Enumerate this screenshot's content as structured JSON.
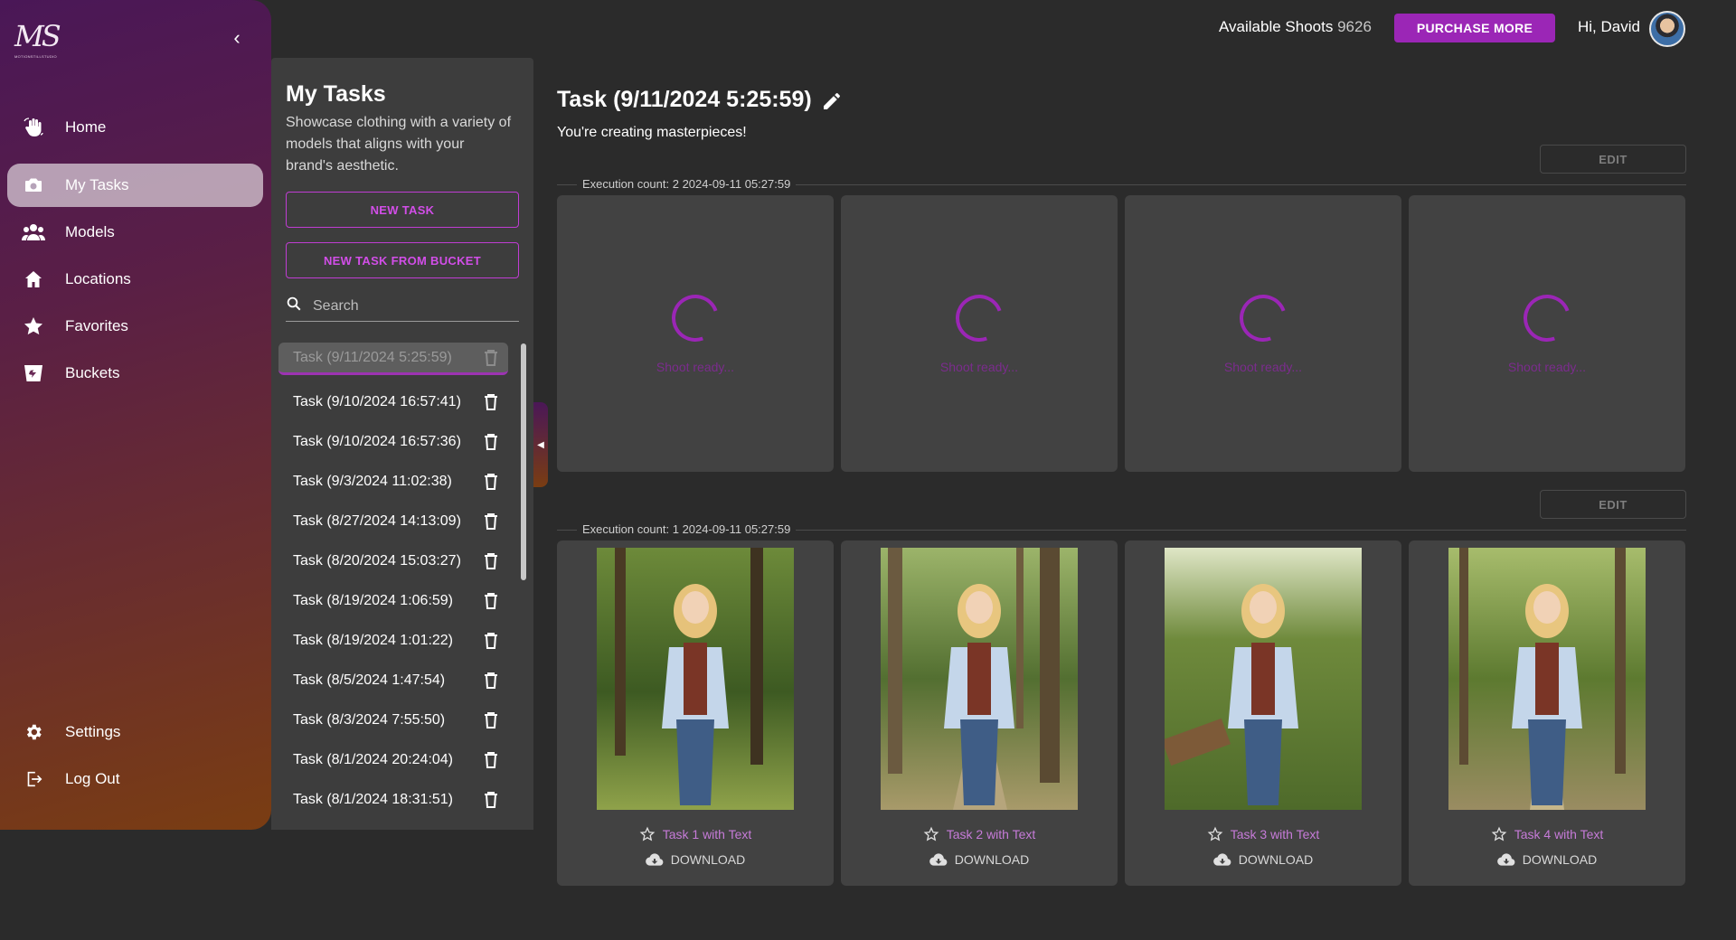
{
  "app": {
    "logo_text": "MS",
    "logo_tagline": "MOTIONSTILLSTUDIO"
  },
  "sidebar": {
    "items": [
      {
        "label": "Home",
        "icon": "waving-hand-icon"
      },
      {
        "label": "My Tasks",
        "icon": "camera-icon",
        "active": true
      },
      {
        "label": "Models",
        "icon": "people-icon"
      },
      {
        "label": "Locations",
        "icon": "house-icon"
      },
      {
        "label": "Favorites",
        "icon": "star-icon"
      },
      {
        "label": "Buckets",
        "icon": "bucket-icon"
      }
    ],
    "bottom_items": [
      {
        "label": "Settings",
        "icon": "gear-icon"
      },
      {
        "label": "Log Out",
        "icon": "logout-icon"
      }
    ]
  },
  "tasks_panel": {
    "title": "My Tasks",
    "description": "Showcase clothing with a variety of models that aligns with your brand's aesthetic.",
    "new_task_label": "NEW TASK",
    "new_task_bucket_label": "NEW TASK FROM BUCKET",
    "search_placeholder": "Search",
    "tasks": [
      "Task (9/11/2024 5:25:59)",
      "Task (9/10/2024 16:57:41)",
      "Task (9/10/2024 16:57:36)",
      "Task (9/3/2024 11:02:38)",
      "Task (8/27/2024 14:13:09)",
      "Task (8/20/2024 15:03:27)",
      "Task (8/19/2024 1:06:59)",
      "Task (8/19/2024 1:01:22)",
      "Task (8/5/2024 1:47:54)",
      "Task (8/3/2024 7:55:50)",
      "Task (8/1/2024 20:24:04)",
      "Task (8/1/2024 18:31:51)"
    ]
  },
  "header": {
    "available_label": "Available Shoots",
    "available_count": "9626",
    "purchase_label": "PURCHASE MORE",
    "greeting": "Hi, David"
  },
  "main": {
    "title": "Task (9/11/2024 5:25:59)",
    "subtitle": "You're creating masterpieces!",
    "edit_label": "EDIT",
    "executions": [
      {
        "label": "Execution count: 2  2024-09-11 05:27:59",
        "state": "loading",
        "loading_text": "Shoot ready...",
        "count": 4
      },
      {
        "label": "Execution count: 1  2024-09-11 05:27:59",
        "state": "done",
        "download_label": "DOWNLOAD",
        "results": [
          {
            "title": "Task 1 with Text"
          },
          {
            "title": "Task 2 with Text"
          },
          {
            "title": "Task 3 with Text"
          },
          {
            "title": "Task 4 with Text"
          }
        ]
      }
    ]
  },
  "colors": {
    "accent": "#9b26b6",
    "accent_text": "#d24ee8",
    "background": "#2b2b2b",
    "panel": "#3d3d3d",
    "card": "#424242"
  }
}
